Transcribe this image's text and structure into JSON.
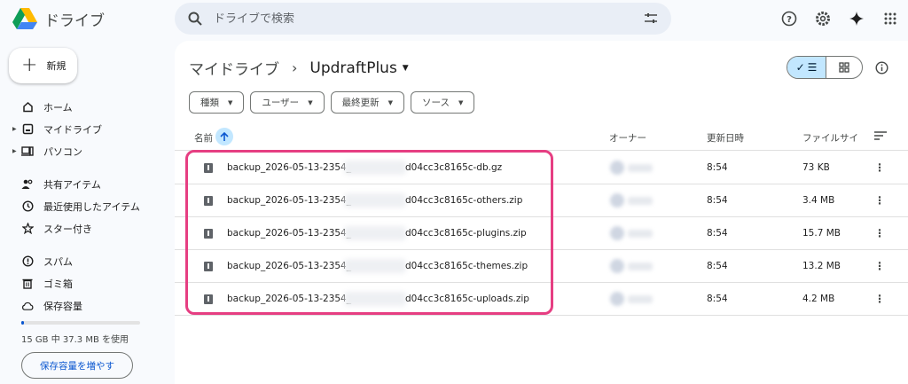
{
  "app": {
    "name": "ドライブ"
  },
  "search": {
    "placeholder": "ドライブで検索"
  },
  "sidebar": {
    "new_label": "新規",
    "items": [
      {
        "label": "ホーム",
        "icon": "home-icon"
      },
      {
        "label": "マイドライブ",
        "icon": "my-drive-icon",
        "expandable": true
      },
      {
        "label": "パソコン",
        "icon": "computers-icon",
        "expandable": true
      },
      {
        "label": "共有アイテム",
        "icon": "shared-icon"
      },
      {
        "label": "最近使用したアイテム",
        "icon": "recent-icon"
      },
      {
        "label": "スター付き",
        "icon": "star-icon"
      },
      {
        "label": "スパム",
        "icon": "spam-icon"
      },
      {
        "label": "ゴミ箱",
        "icon": "trash-icon"
      },
      {
        "label": "保存容量",
        "icon": "cloud-icon"
      }
    ],
    "storage_text": "15 GB 中 37.3 MB を使用",
    "storage_fraction": 0.0025,
    "storage_button": "保存容量を増やす"
  },
  "breadcrumb": {
    "parent": "マイドライブ",
    "current": "UpdraftPlus"
  },
  "filters": [
    "種類",
    "ユーザー",
    "最終更新",
    "ソース"
  ],
  "table": {
    "columns": {
      "name": "名前",
      "owner": "オーナー",
      "modified": "更新日時",
      "size": "ファイルサイ"
    },
    "rows": [
      {
        "name_prefix": "backup_2026-05-13-2354_",
        "name_suffix": "d04cc3c8165c-db.gz",
        "modified": "8:54",
        "size": "73 KB"
      },
      {
        "name_prefix": "backup_2026-05-13-2354_",
        "name_suffix": "d04cc3c8165c-others.zip",
        "modified": "8:54",
        "size": "3.4 MB"
      },
      {
        "name_prefix": "backup_2026-05-13-2354_",
        "name_suffix": "d04cc3c8165c-plugins.zip",
        "modified": "8:54",
        "size": "15.7 MB"
      },
      {
        "name_prefix": "backup_2026-05-13-2354_",
        "name_suffix": "d04cc3c8165c-themes.zip",
        "modified": "8:54",
        "size": "13.2 MB"
      },
      {
        "name_prefix": "backup_2026-05-13-2354_",
        "name_suffix": "d04cc3c8165c-uploads.zip",
        "modified": "8:54",
        "size": "4.2 MB"
      }
    ]
  },
  "colors": {
    "accent": "#0b57d0",
    "highlight": "#e63e82",
    "selected": "#c2e7ff"
  }
}
